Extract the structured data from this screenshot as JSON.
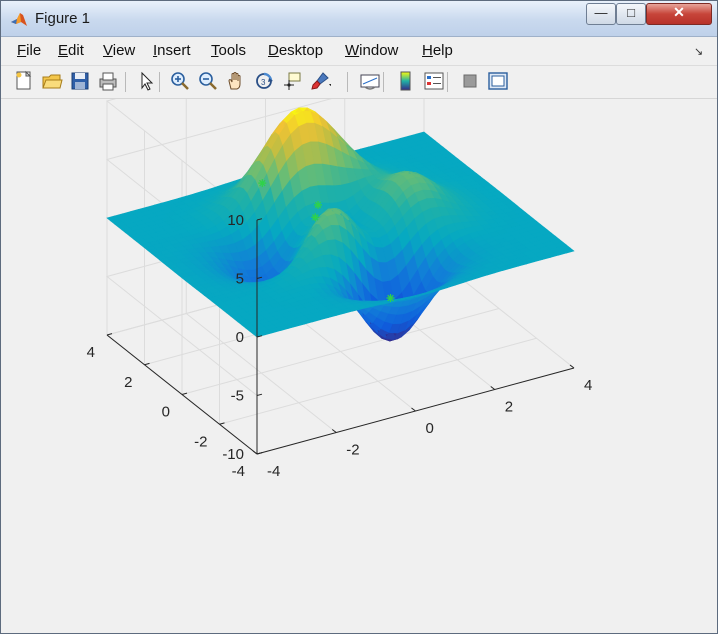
{
  "window": {
    "title": "Figure 1"
  },
  "menu": [
    {
      "key": "file",
      "underline": "F",
      "rest": "ile"
    },
    {
      "key": "edit",
      "underline": "E",
      "rest": "dit"
    },
    {
      "key": "view",
      "underline": "V",
      "rest": "iew"
    },
    {
      "key": "insert",
      "underline": "I",
      "rest": "nsert"
    },
    {
      "key": "tools",
      "underline": "T",
      "rest": "ools"
    },
    {
      "key": "desktop",
      "underline": "D",
      "rest": "esktop"
    },
    {
      "key": "window",
      "underline": "W",
      "rest": "indow"
    },
    {
      "key": "help",
      "underline": "H",
      "rest": "elp"
    }
  ],
  "toolbar": [
    "new-figure-icon",
    "open-file-icon",
    "save-icon",
    "print-icon",
    "pointer-icon",
    "zoom-in-icon",
    "zoom-out-icon",
    "pan-icon",
    "rotate-3d-icon",
    "data-cursor-icon",
    "brush-icon",
    "link-plot-icon",
    "colorbar-icon",
    "legend-icon",
    "hide-plot-tools-icon",
    "show-plot-tools-icon"
  ],
  "chart_data": {
    "type": "surface",
    "function": "peaks",
    "colormap": "parula",
    "grid": true,
    "xlim": [
      -4,
      4
    ],
    "ylim": [
      -4,
      4
    ],
    "zlim": [
      -10,
      10
    ],
    "x_ticks": [
      "-4",
      "-2",
      "0",
      "2",
      "4"
    ],
    "y_ticks": [
      "-4",
      "-2",
      "0",
      "2",
      "4"
    ],
    "z_ticks": [
      "-10",
      "-5",
      "0",
      "5",
      "10"
    ],
    "markers": [
      {
        "x": -1.5,
        "y": 1.0,
        "z": 4.5
      },
      {
        "x": 0.0,
        "y": 1.2,
        "z": 1.0
      },
      {
        "x": -0.4,
        "y": 0.5,
        "z": 1.2
      },
      {
        "x": 0.6,
        "y": -1.4,
        "z": -4.2
      }
    ],
    "marker_color": "#2fd24a",
    "surface_edge_color": "#00000000"
  },
  "colors": {
    "parula_low": "#352a87",
    "parula_mid": "#21b1a6",
    "parula_high": "#f9fb0e"
  }
}
